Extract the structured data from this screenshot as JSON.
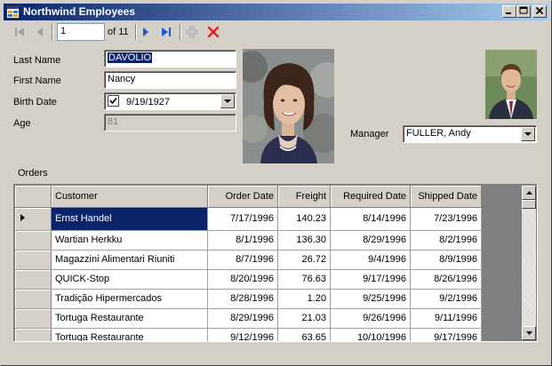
{
  "window": {
    "title": "Northwind Employees"
  },
  "navigator": {
    "position": "1",
    "count_label": "of 11"
  },
  "fields": {
    "last_name_label": "Last Name",
    "last_name": "DAVOLIO",
    "first_name_label": "First Name",
    "first_name": "Nancy",
    "birth_date_label": "Birth Date",
    "birth_date": "9/19/1927",
    "birth_date_checked": true,
    "age_label": "Age",
    "age": "81",
    "manager_label": "Manager",
    "manager": "FULLER, Andy"
  },
  "orders": {
    "label": "Orders",
    "columns": [
      "Customer",
      "Order Date",
      "Freight",
      "Required Date",
      "Shipped Date"
    ],
    "rows": [
      [
        "Ernst Handel",
        "7/17/1996",
        "140.23",
        "8/14/1996",
        "7/23/1996"
      ],
      [
        "Wartian Herkku",
        "8/1/1996",
        "136.30",
        "8/29/1996",
        "8/2/1996"
      ],
      [
        "Magazzini Alimentari Riuniti",
        "8/7/1996",
        "26.72",
        "9/4/1996",
        "8/9/1996"
      ],
      [
        "QUICK-Stop",
        "8/20/1996",
        "76.63",
        "9/17/1996",
        "8/26/1996"
      ],
      [
        "Tradição Hipermercados",
        "8/28/1996",
        "1.20",
        "9/25/1996",
        "9/2/1996"
      ],
      [
        "Tortuga Restaurante",
        "8/29/1996",
        "21.03",
        "9/26/1996",
        "9/11/1996"
      ],
      [
        "Tortuga Restaurante",
        "9/12/1996",
        "63.65",
        "10/10/1996",
        "9/17/1996"
      ]
    ],
    "selected_row": 0
  },
  "colors": {
    "title_start": "#0a246a",
    "title_end": "#a6caf0",
    "selection": "#0a246a",
    "delete_red": "#e02020",
    "nav_blue": "#1a56d6"
  },
  "icons": [
    "app-icon",
    "first-record-icon",
    "previous-record-icon",
    "next-record-icon",
    "last-record-icon",
    "add-record-icon",
    "delete-record-icon"
  ]
}
